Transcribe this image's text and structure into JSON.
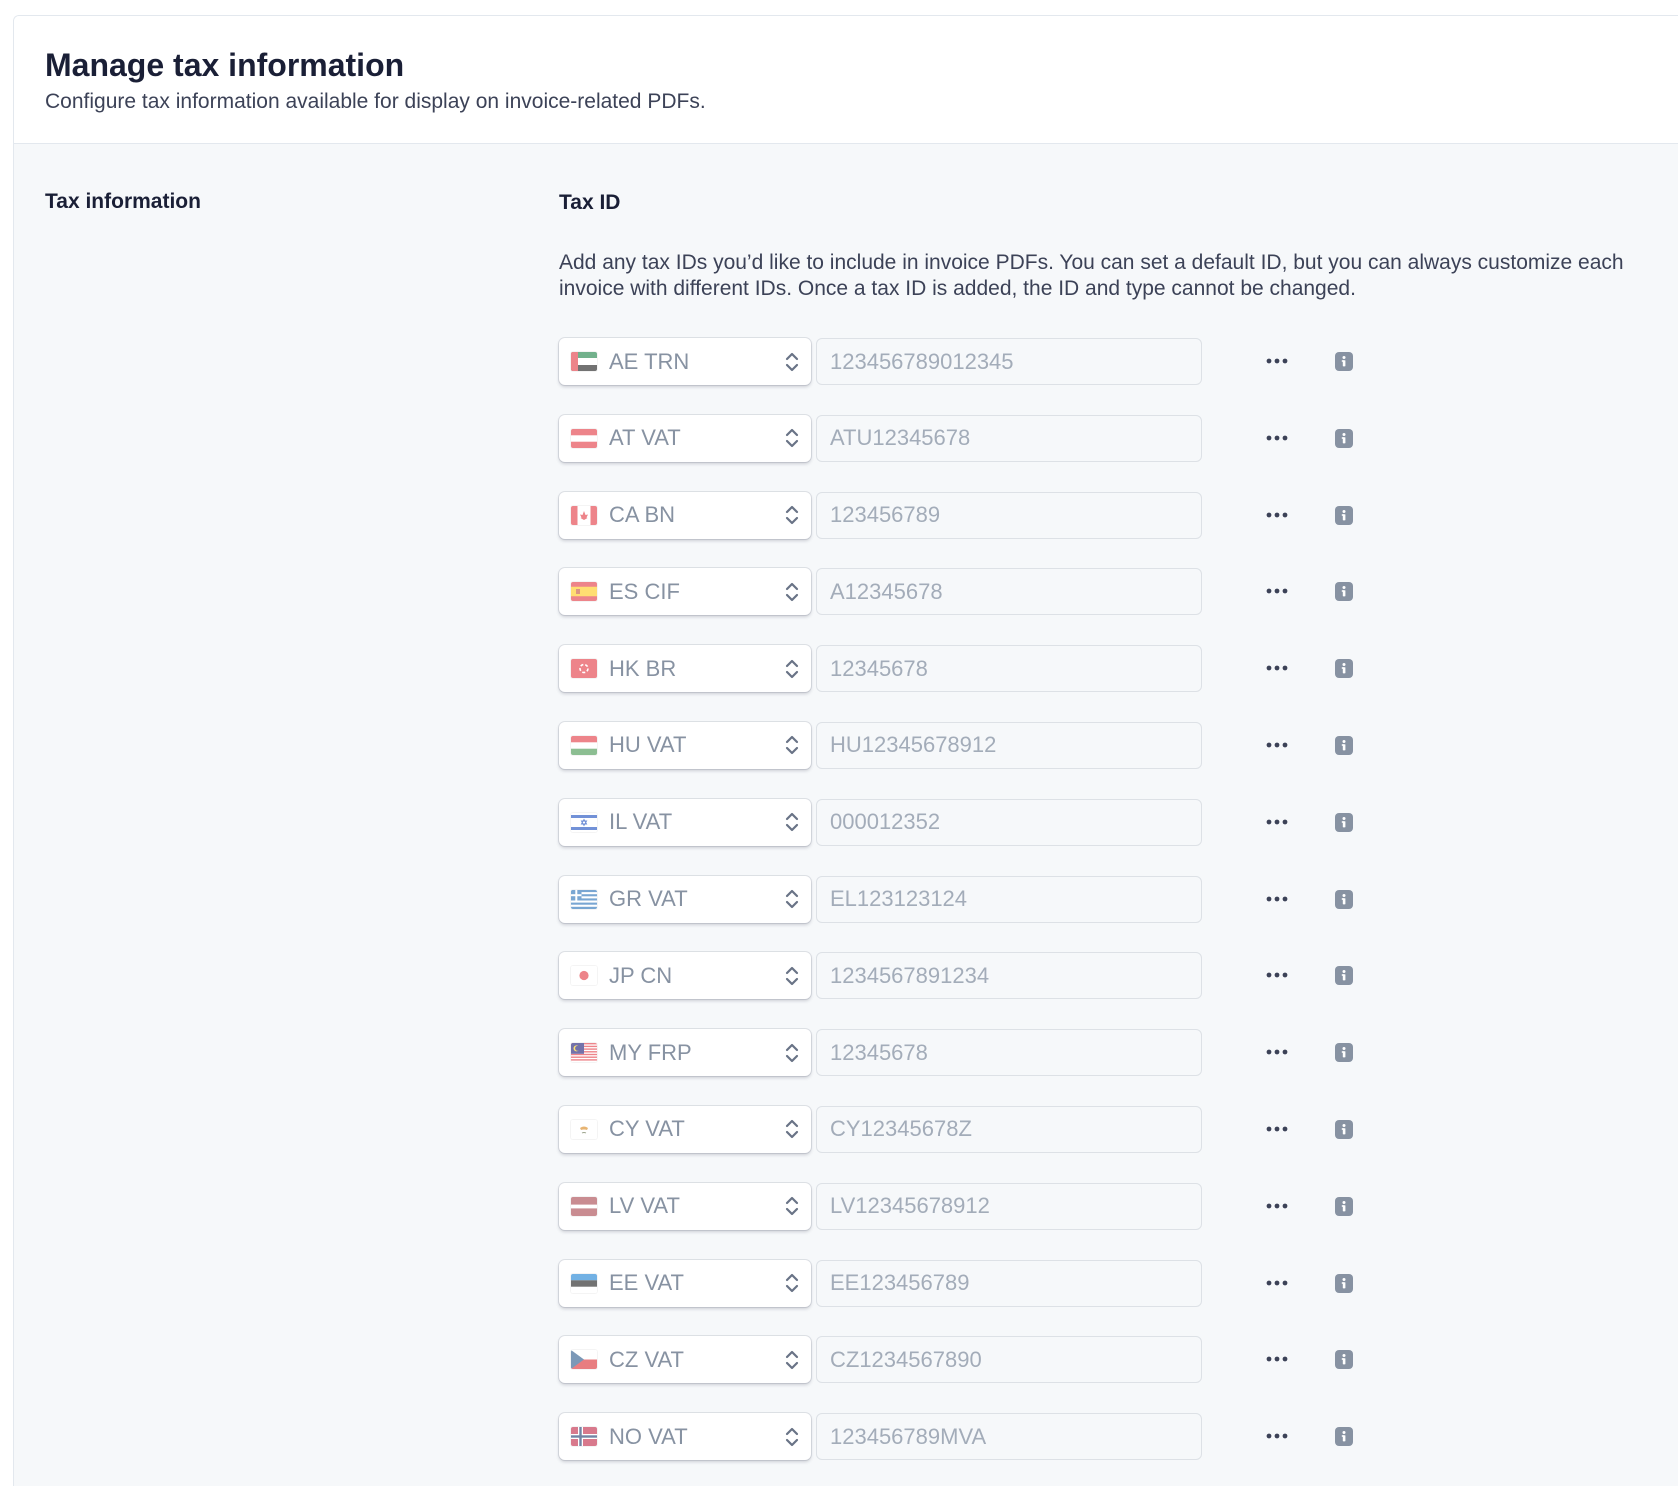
{
  "header": {
    "title": "Manage tax information",
    "subtitle": "Configure tax information available for display on invoice-related PDFs."
  },
  "section": {
    "label": "Tax information",
    "field_label": "Tax ID",
    "help_text": "Add any tax IDs you’d like to include in invoice PDFs. You can set a default ID, but you can always customize each invoice with different IDs. Once a tax ID is added, the ID and type cannot be changed."
  },
  "tax_ids": [
    {
      "type": "AE TRN",
      "value": "123456789012345",
      "flag": "ae-flag-icon"
    },
    {
      "type": "AT VAT",
      "value": "ATU12345678",
      "flag": "at-flag-icon"
    },
    {
      "type": "CA BN",
      "value": "123456789",
      "flag": "ca-flag-icon"
    },
    {
      "type": "ES CIF",
      "value": "A12345678",
      "flag": "es-flag-icon"
    },
    {
      "type": "HK BR",
      "value": "12345678",
      "flag": "hk-flag-icon"
    },
    {
      "type": "HU VAT",
      "value": "HU12345678912",
      "flag": "hu-flag-icon"
    },
    {
      "type": "IL VAT",
      "value": "000012352",
      "flag": "il-flag-icon"
    },
    {
      "type": "GR VAT",
      "value": "EL123123124",
      "flag": "gr-flag-icon"
    },
    {
      "type": "JP CN",
      "value": "1234567891234",
      "flag": "jp-flag-icon"
    },
    {
      "type": "MY FRP",
      "value": "12345678",
      "flag": "my-flag-icon"
    },
    {
      "type": "CY VAT",
      "value": "CY12345678Z",
      "flag": "cy-flag-icon"
    },
    {
      "type": "LV VAT",
      "value": "LV12345678912",
      "flag": "lv-flag-icon"
    },
    {
      "type": "EE VAT",
      "value": "EE123456789",
      "flag": "ee-flag-icon"
    },
    {
      "type": "CZ VAT",
      "value": "CZ1234567890",
      "flag": "cz-flag-icon"
    },
    {
      "type": "NO VAT",
      "value": "123456789MVA",
      "flag": "no-flag-icon"
    }
  ],
  "icons": {
    "more": "more-options-icon",
    "info": "info-icon",
    "select": "chevron-up-down-icon"
  },
  "colors": {
    "page_background": "#f6f8fa",
    "header_background": "#ffffff",
    "muted_text": "#8792a2",
    "heading_text": "#1a1f36"
  }
}
